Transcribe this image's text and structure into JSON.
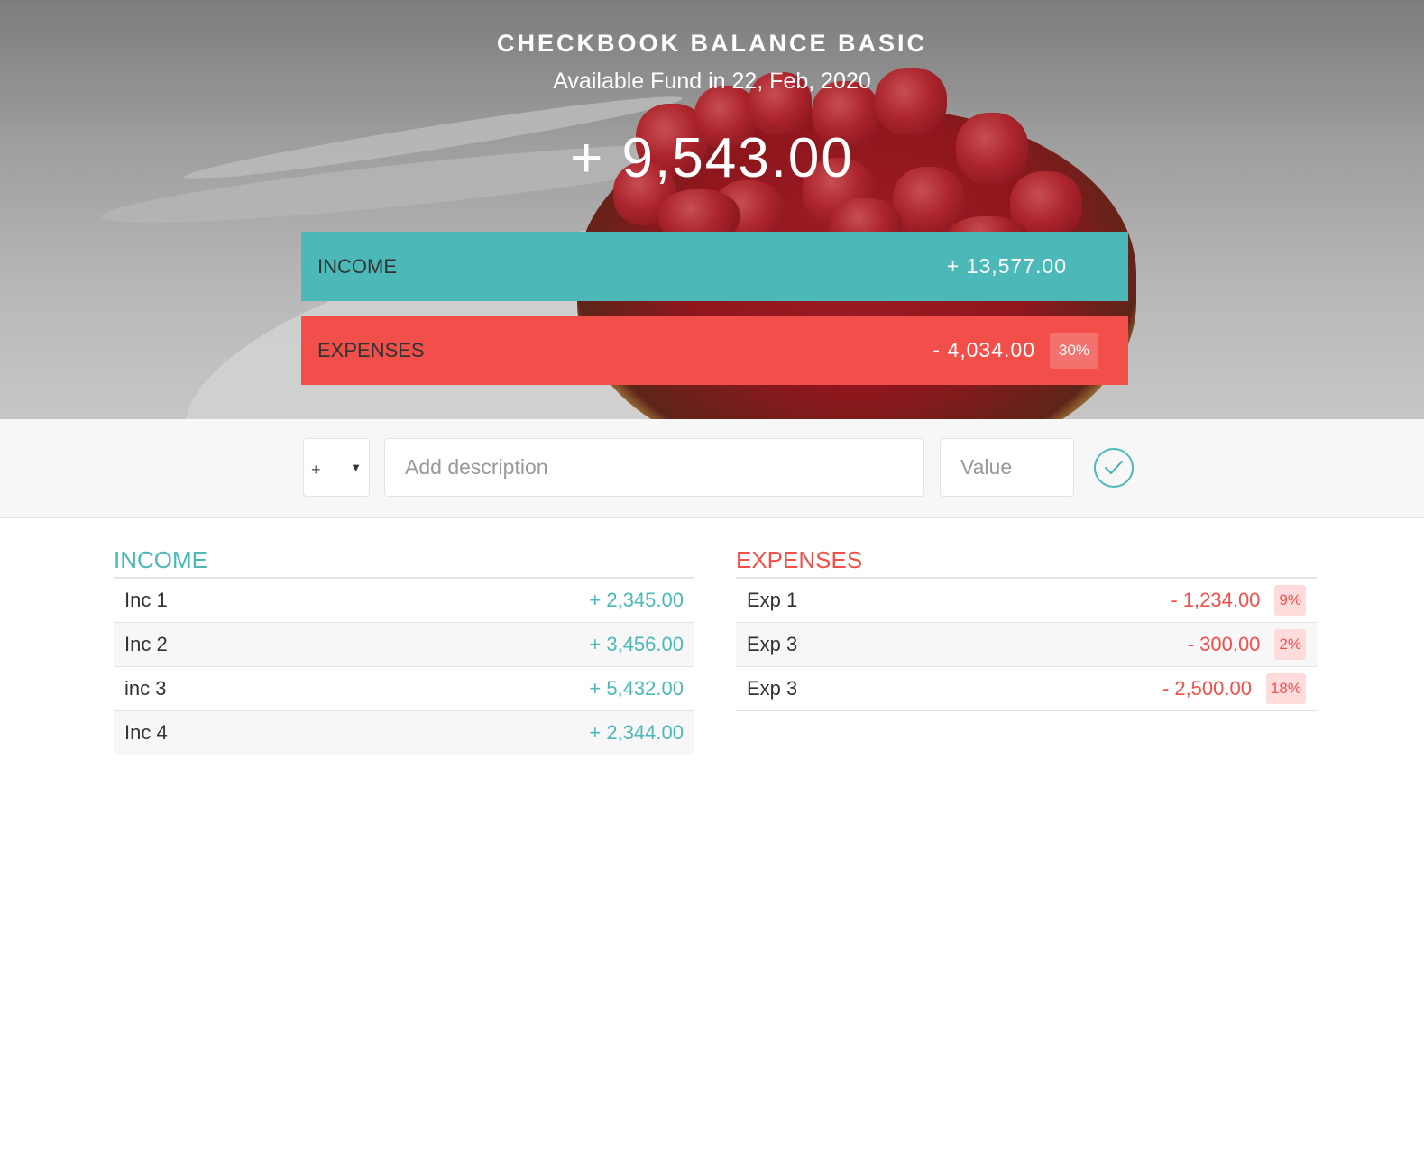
{
  "header": {
    "title": "CHECKBOOK BALANCE BASIC",
    "subtitle": "Available Fund in 22, Feb, 2020",
    "balance": "+ 9,543.00"
  },
  "summary": {
    "income_label": "INCOME",
    "income_value": "+ 13,577.00",
    "expenses_label": "EXPENSES",
    "expenses_value": "- 4,034.00",
    "expenses_percentage": "30%"
  },
  "add_form": {
    "type_selected": "+",
    "description_placeholder": "Add description",
    "value_placeholder": "Value"
  },
  "income": {
    "title": "INCOME",
    "items": [
      {
        "description": "Inc 1",
        "value": "+ 2,345.00"
      },
      {
        "description": "Inc 2",
        "value": "+ 3,456.00"
      },
      {
        "description": "inc 3",
        "value": "+ 5,432.00"
      },
      {
        "description": "Inc 4",
        "value": "+ 2,344.00"
      }
    ]
  },
  "expenses": {
    "title": "EXPENSES",
    "items": [
      {
        "description": "Exp 1",
        "value": "- 1,234.00",
        "percentage": "9%"
      },
      {
        "description": "Exp 3",
        "value": "- 300.00",
        "percentage": "2%"
      },
      {
        "description": "Exp 3",
        "value": "- 2,500.00",
        "percentage": "18%"
      }
    ]
  },
  "colors": {
    "income": "#4cb9b8",
    "expenses": "#f24f4a"
  },
  "icons": {
    "add_button": "checkmark-circle-icon",
    "select_caret": "caret-down-icon"
  }
}
